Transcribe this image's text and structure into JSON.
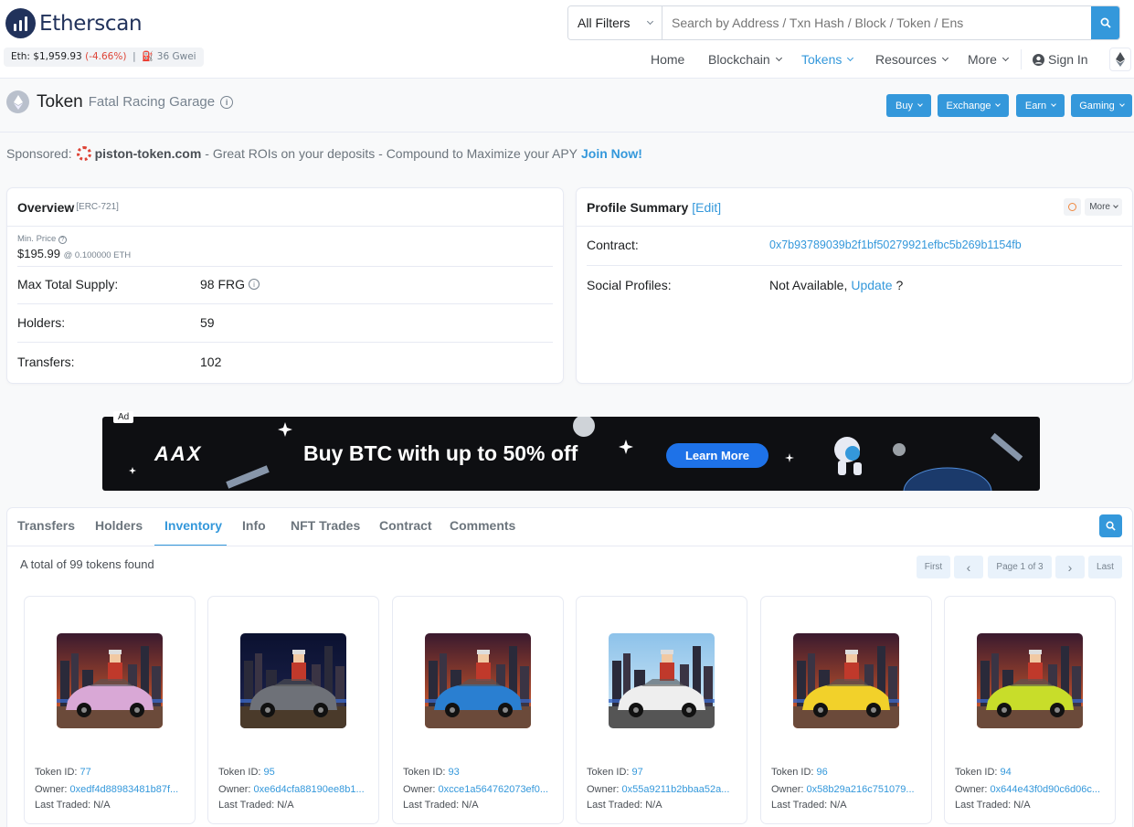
{
  "brand": {
    "name": "Etherscan"
  },
  "ticker": {
    "eth_label": "Eth:",
    "eth_price": "$1,959.93",
    "eth_change": "(-4.66%)",
    "sep": "|",
    "gas": "36 Gwei"
  },
  "search": {
    "filter": "All Filters",
    "placeholder": "Search by Address / Txn Hash / Block / Token / Ens"
  },
  "nav": {
    "home": "Home",
    "blockchain": "Blockchain",
    "tokens": "Tokens",
    "resources": "Resources",
    "more": "More",
    "sign_in": "Sign In"
  },
  "title": {
    "main": "Token",
    "sub": "Fatal Racing Garage",
    "info": "i"
  },
  "actions": {
    "buy": "Buy",
    "exchange": "Exchange",
    "earn": "Earn",
    "gaming": "Gaming"
  },
  "sponsor": {
    "label": "Sponsored:",
    "site": "piston-token.com",
    "text": "- Great ROIs on your deposits - Compound to Maximize your APY",
    "cta": "Join Now!"
  },
  "overview": {
    "title": "Overview",
    "standard": "[ERC-721]",
    "min_price_label": "Min. Price",
    "min_price": "$195.99",
    "min_price_eth": "@ 0.100000 ETH",
    "supply_label": "Max Total Supply:",
    "supply": "98 FRG",
    "holders_label": "Holders:",
    "holders": "59",
    "transfers_label": "Transfers:",
    "transfers": "102"
  },
  "profile": {
    "title": "Profile Summary",
    "edit": "[Edit]",
    "more": "More",
    "contract_label": "Contract:",
    "contract": "0x7b93789039b2f1bf50279921efbc5b269b1154fb",
    "social_label": "Social Profiles:",
    "social_value": "Not Available,",
    "social_update": "Update",
    "social_q": "?"
  },
  "ad": {
    "tag": "Ad",
    "brand": "AAX",
    "headline": "Buy BTC with up to 50% off",
    "cta": "Learn More"
  },
  "tabs": {
    "transfers": "Transfers",
    "holders": "Holders",
    "inventory": "Inventory",
    "info": "Info",
    "nft_trades": "NFT Trades",
    "contract": "Contract",
    "comments": "Comments"
  },
  "inventory": {
    "total": "A total of 99 tokens found",
    "pager": {
      "first": "First",
      "prev": "‹",
      "page": "Page 1 of 3",
      "next": "›",
      "last": "Last"
    },
    "token_id_label": "Token ID:",
    "owner_label": "Owner:",
    "last_traded_label": "Last Traded:",
    "items": [
      {
        "id": "77",
        "owner": "0xedf4d88983481b87f...",
        "last_traded": "N/A",
        "sky_top": "#3a1a2e",
        "sky_bottom": "#e8622a",
        "car": "#d9a8d6",
        "road": "#6b4a3a"
      },
      {
        "id": "95",
        "owner": "0xe6d4cfa88190ee8b1...",
        "last_traded": "N/A",
        "sky_top": "#0b1130",
        "sky_bottom": "#1e2550",
        "car": "#6e7178",
        "road": "#4a3a2a"
      },
      {
        "id": "93",
        "owner": "0xcce1a564762073ef0...",
        "last_traded": "N/A",
        "sky_top": "#3a1a2e",
        "sky_bottom": "#e8622a",
        "car": "#2a7fd1",
        "road": "#6b4a3a"
      },
      {
        "id": "97",
        "owner": "0x55a9211b2bbaa52a...",
        "last_traded": "N/A",
        "sky_top": "#8dc2ea",
        "sky_bottom": "#d7ecf7",
        "car": "#eeeeee",
        "road": "#555555"
      },
      {
        "id": "96",
        "owner": "0x58b29a216c751079...",
        "last_traded": "N/A",
        "sky_top": "#3a1a2e",
        "sky_bottom": "#e8622a",
        "car": "#f2d12a",
        "road": "#6b4a3a"
      },
      {
        "id": "94",
        "owner": "0x644e43f0d90c6d06c...",
        "last_traded": "N/A",
        "sky_top": "#3a1a2e",
        "sky_bottom": "#e8622a",
        "car": "#c8dd2a",
        "road": "#6b4a3a"
      }
    ]
  },
  "colors": {
    "accent": "#3498db",
    "negative": "#de4437",
    "brand_dark": "#21325b"
  }
}
